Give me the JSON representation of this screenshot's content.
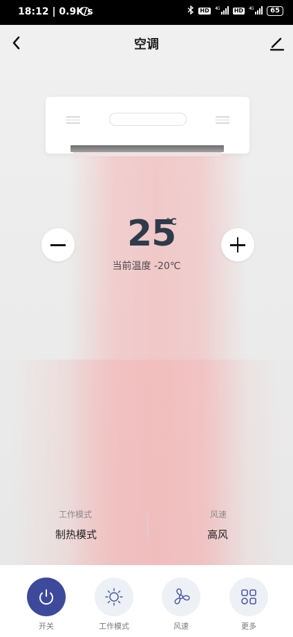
{
  "status_bar": {
    "time": "18:12 | 0.9K/s",
    "battery": "65",
    "hd_badge": "HD",
    "network": "4G"
  },
  "header": {
    "title": "空调"
  },
  "temperature": {
    "value": "25",
    "unit": "℃",
    "current_label": "当前温度 -20℃"
  },
  "info": {
    "mode_label": "工作模式",
    "mode_value": "制热模式",
    "fan_label": "风速",
    "fan_value": "高风"
  },
  "bottom_nav": [
    {
      "label": "开关",
      "icon": "power-icon"
    },
    {
      "label": "工作模式",
      "icon": "sun-icon"
    },
    {
      "label": "风速",
      "icon": "fan-icon"
    },
    {
      "label": "更多",
      "icon": "grid-icon"
    }
  ],
  "colors": {
    "accent": "#3d4a9b",
    "icon_accent": "#4a57a8",
    "temp_text": "#2d3b4b",
    "heat_glow": "#f4aaaa"
  }
}
